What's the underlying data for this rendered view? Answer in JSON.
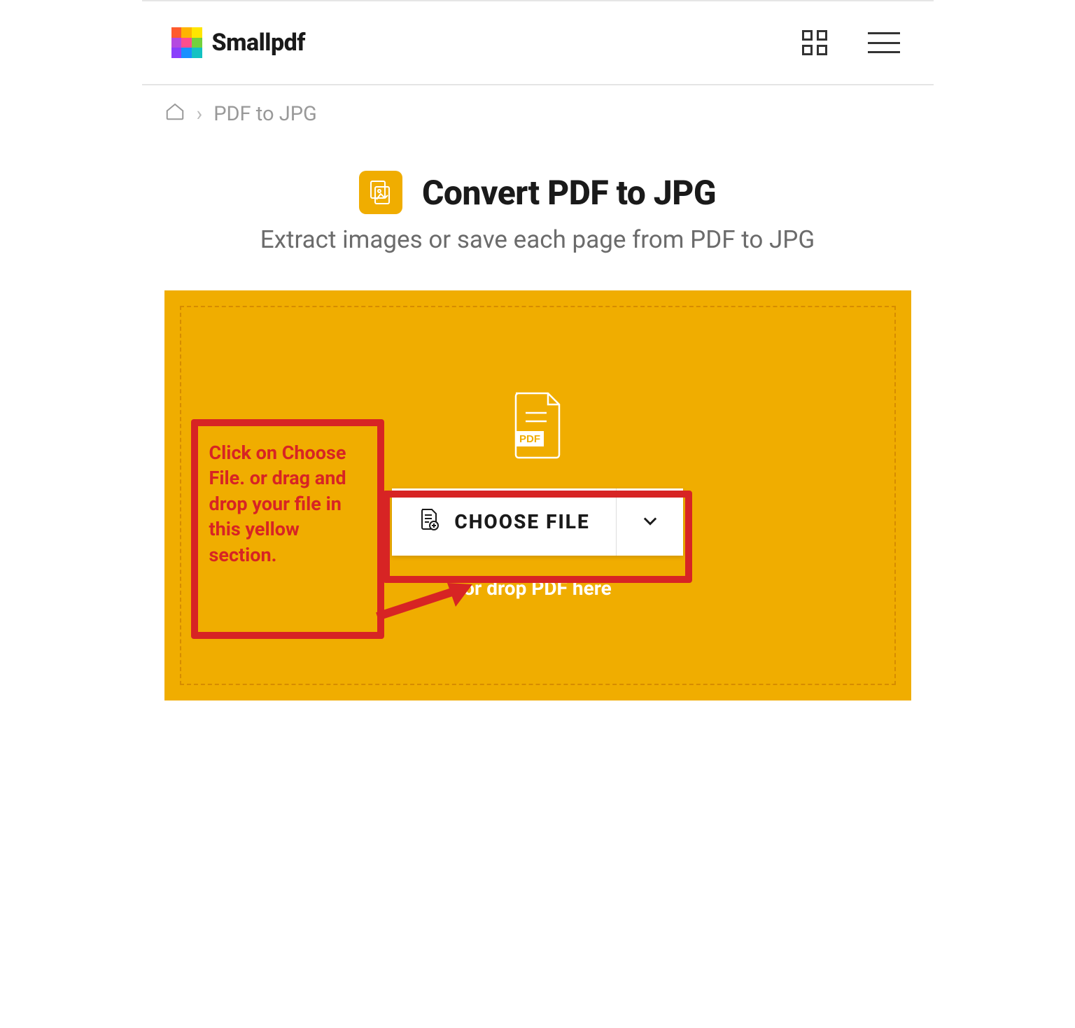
{
  "brand": {
    "name": "Smallpdf"
  },
  "breadcrumb": {
    "current": "PDF to JPG",
    "separator": "›"
  },
  "hero": {
    "title": "Convert PDF to JPG",
    "subtitle": "Extract images or save each page from PDF to JPG"
  },
  "dropzone": {
    "pdf_label": "PDF",
    "choose_label": "CHOOSE FILE",
    "drop_hint": "or drop PDF here"
  },
  "annotation": {
    "text": "Click on Choose File. or drag and drop your file in this yellow section."
  },
  "colors": {
    "accent": "#f0ad00",
    "annotation": "#d72424"
  }
}
